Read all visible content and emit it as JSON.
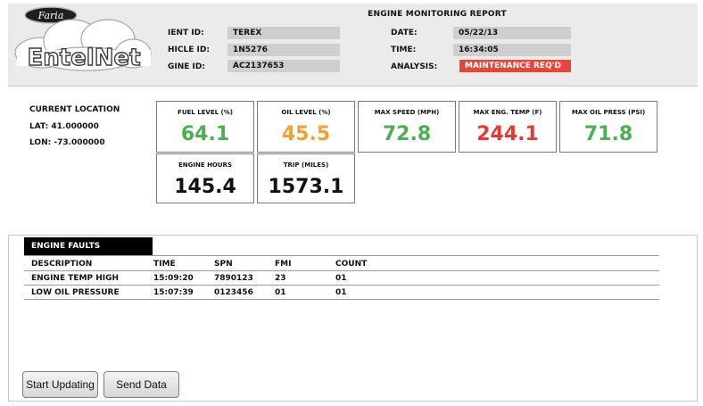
{
  "brand": {
    "top": "Faria",
    "bottom": "EntelNet"
  },
  "report": {
    "title": "ENGINE MONITORING REPORT",
    "client_id_label": "IENT ID:",
    "client_id": "TEREX",
    "vehicle_id_label": "HICLE ID:",
    "vehicle_id": "1N5276",
    "engine_id_label": "GINE ID:",
    "engine_id": "AC2137653",
    "date_label": "DATE:",
    "date": "05/22/13",
    "time_label": "TIME:",
    "time": "16:34:05",
    "analysis_label": "ANALYSIS:",
    "analysis": "MAINTENANCE REQ'D",
    "analysis_color": "#e8463a"
  },
  "location": {
    "title": "CURRENT LOCATION",
    "lat": "LAT:  41.000000",
    "lon": "LON:  -73.000000"
  },
  "gauges": {
    "fuel": {
      "label": "FUEL LEVEL (%)",
      "value": "64.1",
      "color": "#4caf50"
    },
    "oil": {
      "label": "OIL LEVEL (%)",
      "value": "45.5",
      "color": "#f2a12e"
    },
    "speed": {
      "label": "MAX SPEED (MPH)",
      "value": "72.8",
      "color": "#4caf50"
    },
    "engtemp": {
      "label": "MAX ENG. TEMP (F)",
      "value": "244.1",
      "color": "#e53935"
    },
    "oilpress": {
      "label": "MAX OIL PRESS (PSI)",
      "value": "71.8",
      "color": "#4caf50"
    },
    "hours": {
      "label": "ENGINE HOURS",
      "value": "145.4",
      "color": "#111111"
    },
    "trip": {
      "label": "TRIP (MILES)",
      "value": "1573.1",
      "color": "#111111"
    }
  },
  "faults": {
    "tab_label": "ENGINE FAULTS",
    "columns": [
      "DESCRIPTION",
      "TIME",
      "SPN",
      "FMI",
      "COUNT"
    ],
    "rows": [
      [
        "ENGINE TEMP HIGH",
        "15:09:20",
        "7890123",
        "23",
        "01"
      ],
      [
        "LOW OIL PRESSURE",
        "15:07:39",
        "0123456",
        "01",
        "01"
      ]
    ]
  },
  "buttons": {
    "start": "Start Updating",
    "send": "Send Data"
  }
}
